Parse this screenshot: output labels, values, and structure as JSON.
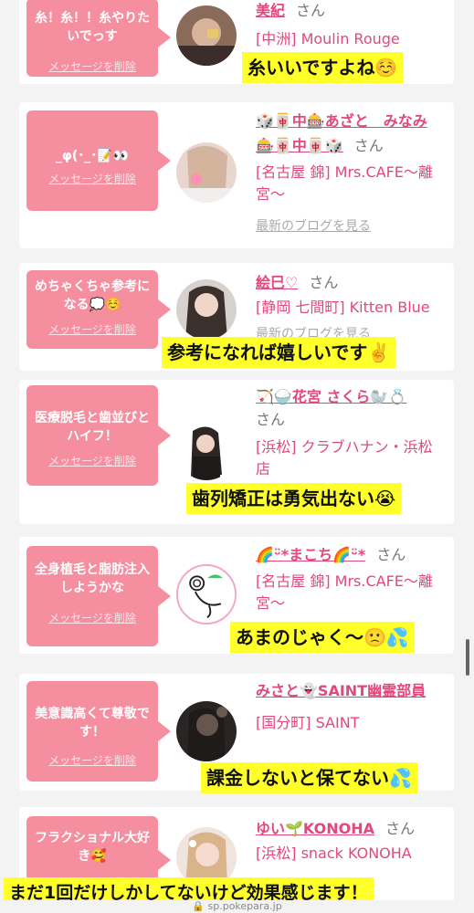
{
  "colors": {
    "accent": "#e2487b",
    "bubble": "#f58fa0",
    "caption_bg": "#ffff2a",
    "page_bg": "#f3f3f3"
  },
  "delete_label": "メッセージを削除",
  "san": "さん",
  "blog_label": "最新のブログを見る",
  "cards": [
    {
      "message": "糸！糸！！糸やりたいでっす",
      "name": "美紀",
      "shop": "[中洲] Moulin Rouge",
      "caption": "糸いいですよね☺️"
    },
    {
      "message": "_φ(･_･📝👀",
      "name_line1": "🎲🀄中🎰あざと　みなみ",
      "name_line2": "🎰🀄中🀄🎲",
      "shop": "[名古屋 錦] Mrs.CAFE〜離宮〜"
    },
    {
      "message": "めちゃくちゃ参考になる💭☺️",
      "name": "絵巳♡",
      "shop": "[静岡 七間町] Kitten Blue",
      "caption": "参考になれば嬉しいです✌️"
    },
    {
      "message": "医療脱毛と歯並びとハイフ！",
      "name": "🏹🍚花宮 さくら🦭💍",
      "shop": "[浜松] クラブハナン・浜松店",
      "caption": "歯列矯正は勇気出ない😭"
    },
    {
      "message": "全身植毛と脂肪注入しようかな",
      "name": "🌈ᵕ̈*まこち🌈ᵕ̈*",
      "shop": "[名古屋 錦] Mrs.CAFE〜離宮〜",
      "caption": "あまのじゃく〜🙁💦"
    },
    {
      "message": "美意識高くて尊敬です！",
      "name": "みさと👻SAINT幽霊部員",
      "shop": "[国分町] SAINT",
      "caption": "課金しないと保てない💦"
    },
    {
      "message": "フラクショナル大好き🥰",
      "name": "ゆい🌱KONOHA",
      "shop": "[浜松] snack KONOHA",
      "caption": "まだ1回だけしかしてないけど効果感じます！"
    }
  ],
  "url": "sp.pokepara.jp"
}
